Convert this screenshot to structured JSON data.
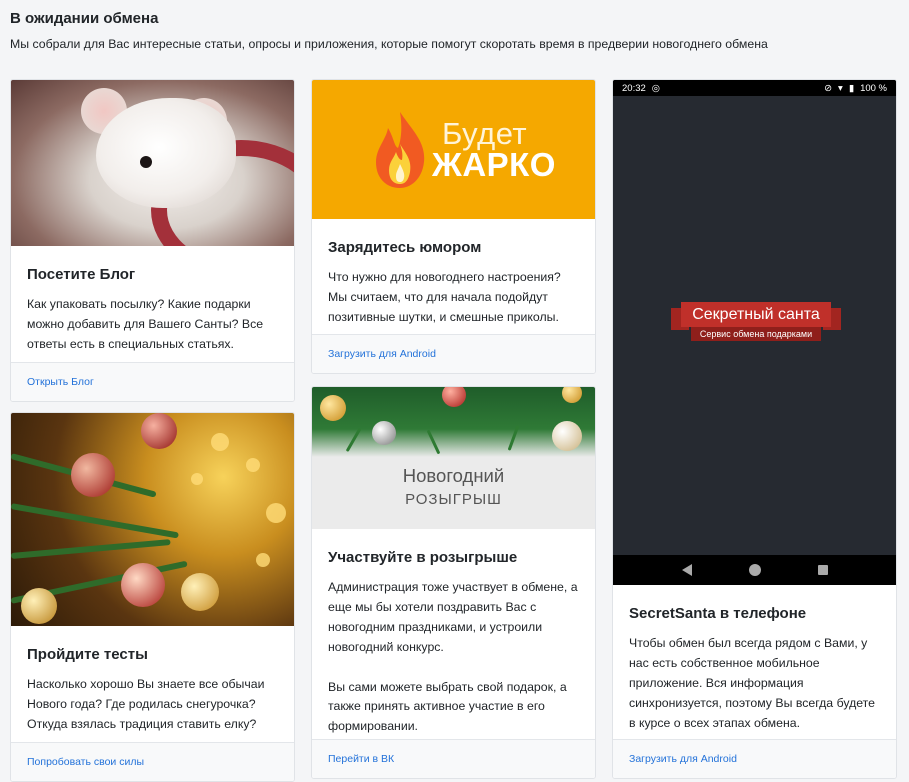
{
  "header": {
    "title": "В ожидании обмена",
    "subtitle": "Мы собрали для Вас интересные статьи, опросы и приложения, которые помогут скоротать время в предверии новогоднего обмена"
  },
  "cards": {
    "blog": {
      "title": "Посетите Блог",
      "text": "Как упаковать посылку? Какие подарки можно добавить для Вашего Санты? Все ответы есть в специальных статьях.",
      "link": "Открыть Блог"
    },
    "tests": {
      "title": "Пройдите тесты",
      "text": "Насколько хорошо Вы знаете все обычаи Нового года? Где родилась снегурочка? Откуда взялась традиция ставить елку?",
      "link": "Попробовать свои силы"
    },
    "humor": {
      "image_text_1": "Будет",
      "image_text_2": "ЖАРКО",
      "title": "Зарядитесь юмором",
      "text": "Что нужно для новогоднего настроения? Мы считаем, что для начала подойдут позитивные шутки, и смешные приколы.",
      "link": "Загрузить для Android"
    },
    "contest": {
      "image_text_1": "Новогодний",
      "image_text_2": "РОЗЫГРЫШ",
      "title": "Участвуйте в розыгрыше",
      "text": "Администрация тоже участвует в обмене, а еще мы бы хотели поздравить Вас с новогодним праздниками, и устроили новогодний конкурс.\n\nВы сами можете выбрать свой подарок, а также принять активное участие в его формировании.",
      "link": "Перейти в ВК"
    },
    "app": {
      "phone": {
        "time": "20:32",
        "battery": "100 %",
        "banner_title": "Секретный санта",
        "banner_subtitle": "Сервис обмена подарками"
      },
      "title": "SecretSanta в телефоне",
      "text": "Чтобы обмен был всегда рядом с Вами, у нас есть собственное мобильное приложение. Вся информация синхронизуется, поэтому Вы всегда будете в курсе о всех этапах обмена.",
      "link": "Загрузить для Android"
    }
  },
  "colors": {
    "link": "#2372d9",
    "humor_bg": "#f5a800",
    "phone_bg": "#262a31",
    "ribbon": "#c0302a"
  },
  "icons": [
    "wifi-icon",
    "battery-icon",
    "mute-icon",
    "nav-back-icon",
    "nav-home-icon",
    "nav-recent-icon",
    "flame-icon"
  ]
}
